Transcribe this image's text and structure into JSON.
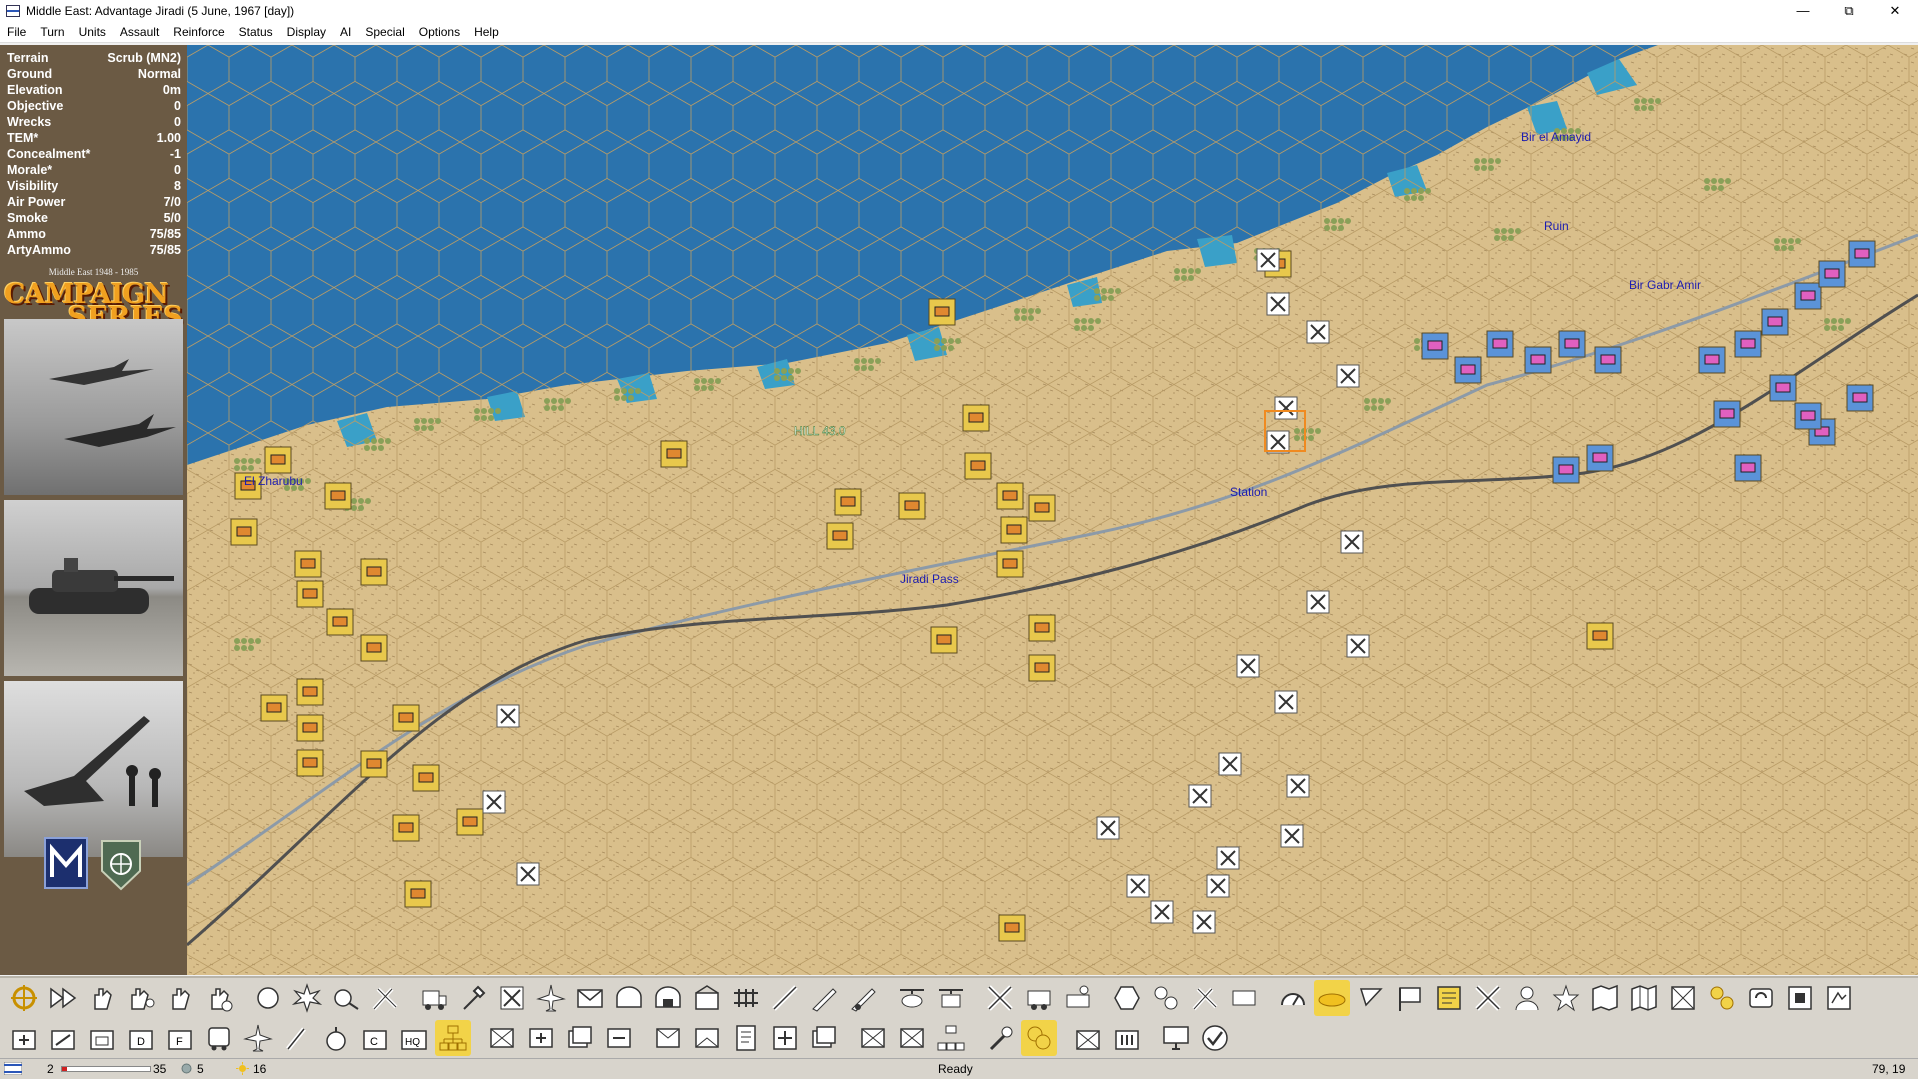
{
  "window": {
    "title": "Middle East: Advantage Jiradi (5 June, 1967 [day])"
  },
  "menu": [
    "File",
    "Turn",
    "Units",
    "Assault",
    "Reinforce",
    "Status",
    "Display",
    "AI",
    "Special",
    "Options",
    "Help"
  ],
  "terrain_info": [
    {
      "label": "Terrain",
      "value": "Scrub (MN2)"
    },
    {
      "label": "Ground",
      "value": "Normal"
    },
    {
      "label": "Elevation",
      "value": "0m"
    },
    {
      "label": "Objective",
      "value": "0"
    },
    {
      "label": "Wrecks",
      "value": "0"
    },
    {
      "label": "TEM*",
      "value": "1.00"
    },
    {
      "label": "Concealment*",
      "value": "-1"
    },
    {
      "label": "Morale*",
      "value": "0"
    },
    {
      "label": "Visibility",
      "value": "8"
    },
    {
      "label": "Air Power",
      "value": "7/0"
    },
    {
      "label": "Smoke",
      "value": "5/0"
    },
    {
      "label": "Ammo",
      "value": "75/85"
    },
    {
      "label": "ArtyAmmo",
      "value": "75/85"
    }
  ],
  "logo": {
    "top_text": "Middle East 1948 - 1985",
    "line1": "CAMPAIGN",
    "line2": "SERIES"
  },
  "map": {
    "labels": [
      "El Zharubu",
      "HILL 43.0",
      "Jiradi Pass",
      "Station",
      "Bir el Amayid",
      "Ruin",
      "Bir Gabr Amir"
    ],
    "colors": {
      "sea": "#2b73ad",
      "shallow": "#3aa0c8",
      "sand": "#d9bf8b",
      "israeli": "#5b93d8",
      "egyptian": "#e8c84c"
    }
  },
  "status": {
    "turn": "2",
    "max_turn": "35",
    "vp": "5",
    "score": "16",
    "message": "Ready",
    "coords": "79, 19",
    "turn_progress": 0.06
  }
}
